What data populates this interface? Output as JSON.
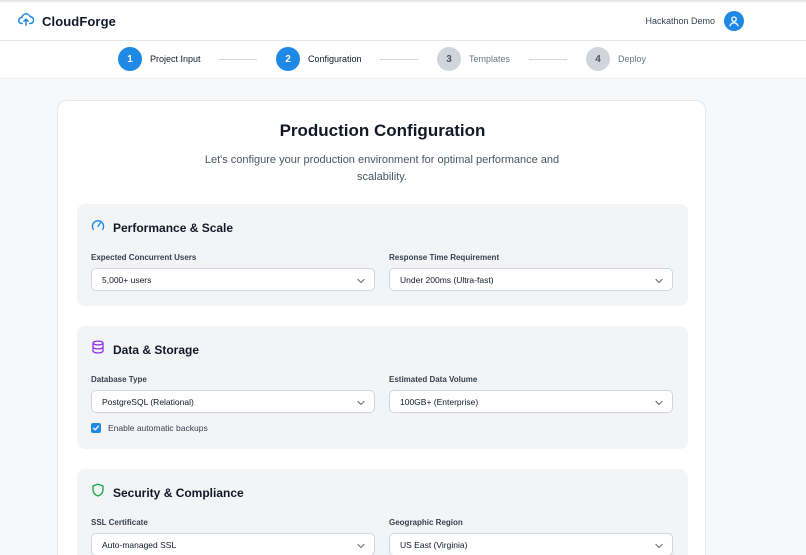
{
  "app": {
    "name": "CloudForge",
    "user_name": "Hackathon Demo",
    "accent": "#1e88e5"
  },
  "steps": [
    {
      "number": "1",
      "label": "Project Input",
      "state": "active"
    },
    {
      "number": "2",
      "label": "Configuration",
      "state": "active"
    },
    {
      "number": "3",
      "label": "Templates",
      "state": "inactive"
    },
    {
      "number": "4",
      "label": "Deploy",
      "state": "inactive"
    }
  ],
  "page": {
    "title": "Production Configuration",
    "subtitle": "Let's configure your production environment for optimal performance and scalability."
  },
  "sections": {
    "performance": {
      "title": "Performance & Scale",
      "icon": "gauge-icon",
      "fields": [
        {
          "label": "Expected Concurrent Users",
          "value": "5,000+ users"
        },
        {
          "label": "Response Time Requirement",
          "value": "Under 200ms (Ultra-fast)"
        }
      ]
    },
    "storage": {
      "title": "Data & Storage",
      "icon": "database-icon",
      "fields": [
        {
          "label": "Database Type",
          "value": "PostgreSQL (Relational)"
        },
        {
          "label": "Estimated Data Volume",
          "value": "100GB+ (Enterprise)"
        }
      ],
      "backups_label": "Enable automatic backups",
      "backups_checked": true
    },
    "security": {
      "title": "Security & Compliance",
      "icon": "shield-icon",
      "fields": [
        {
          "label": "SSL Certificate",
          "value": "Auto-managed SSL"
        },
        {
          "label": "Geographic Region",
          "value": "US East (Virginia)"
        }
      ]
    }
  }
}
